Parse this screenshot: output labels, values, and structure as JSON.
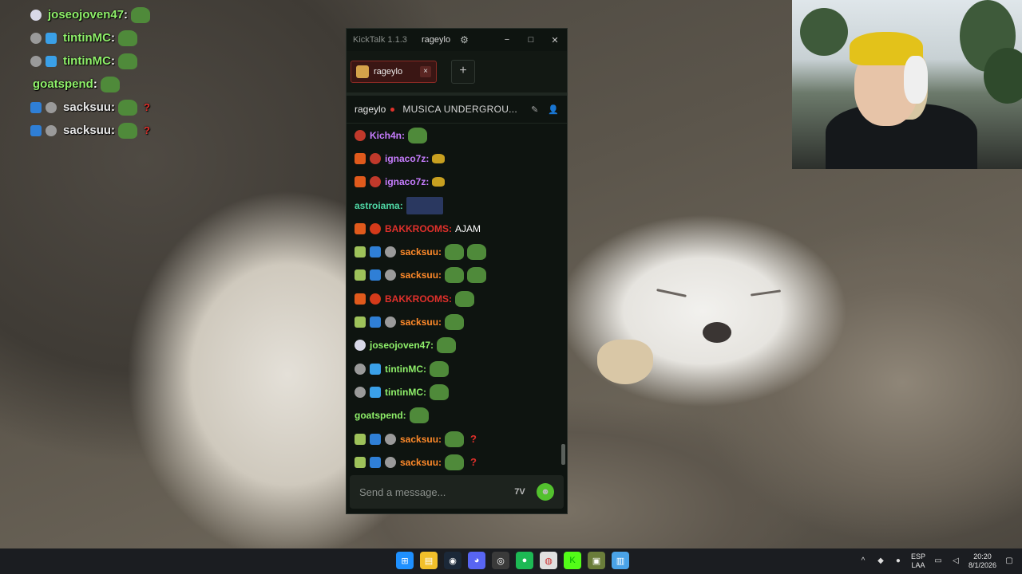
{
  "overlay_chat": [
    {
      "user": "joseojoven47",
      "color": "#8ff06a",
      "badges": [
        "silver-badge"
      ],
      "emotes": [
        "pepe-emote"
      ],
      "text": "",
      "suffix": ""
    },
    {
      "user": "tintinMC",
      "color": "#8ff06a",
      "badges": [
        "gray-badge",
        "cube-badge"
      ],
      "emotes": [
        "pepe-emote"
      ],
      "text": "",
      "suffix": ""
    },
    {
      "user": "tintinMC",
      "color": "#8ff06a",
      "badges": [
        "gray-badge",
        "cube-badge"
      ],
      "emotes": [
        "pepe-emote"
      ],
      "text": "",
      "suffix": ""
    },
    {
      "user": "goatspend",
      "color": "#8ff06a",
      "badges": [],
      "emotes": [
        "pepe-emote"
      ],
      "text": "",
      "suffix": ""
    },
    {
      "user": "sacksuu",
      "color": "#e8e8e8",
      "badges": [
        "sword-badge",
        "gray-badge"
      ],
      "emotes": [
        "pepe-emote"
      ],
      "text": "",
      "suffix": "?"
    },
    {
      "user": "sacksuu",
      "color": "#e8e8e8",
      "badges": [
        "sword-badge",
        "gray-badge"
      ],
      "emotes": [
        "pepe-emote"
      ],
      "text": "",
      "suffix": "?"
    }
  ],
  "window": {
    "app_title": "KickTalk 1.1.3",
    "channel": "rageylo",
    "tab_label": "rageylo",
    "tab_close": "×",
    "add_tab": "+",
    "minimize": "−",
    "maximize": "□",
    "close": "✕"
  },
  "channel_bar": {
    "name": "rageylo",
    "stream_title": "MUSICA UNDERGROU..."
  },
  "messages": [
    {
      "badges": [
        "red-badge"
      ],
      "user": "Kich4n",
      "color": "#c77dff",
      "emotes": [
        "pepe"
      ],
      "text": "",
      "suffix": ""
    },
    {
      "badges": [
        "orange-badge",
        "red-badge"
      ],
      "user": "ignaco7z",
      "color": "#c77dff",
      "emotes": [
        "small"
      ],
      "text": "",
      "suffix": ""
    },
    {
      "badges": [
        "orange-badge",
        "red-badge"
      ],
      "user": "ignaco7z",
      "color": "#c77dff",
      "emotes": [
        "small"
      ],
      "text": "",
      "suffix": ""
    },
    {
      "badges": [],
      "user": "astroiama",
      "color": "#4fd6a4",
      "emotes": [
        "wide"
      ],
      "text": "",
      "suffix": ""
    },
    {
      "badges": [
        "orange-badge",
        "fire-badge"
      ],
      "user": "BAKKROOMS",
      "color": "#e0302b",
      "emotes": [],
      "text": "AJAM",
      "suffix": ""
    },
    {
      "badges": [
        "alien-badge",
        "sword-badge",
        "gray-badge"
      ],
      "user": "sacksuu",
      "color": "#ff8a2a",
      "emotes": [
        "pepe",
        "pepe"
      ],
      "text": "",
      "suffix": ""
    },
    {
      "badges": [
        "alien-badge",
        "sword-badge",
        "gray-badge"
      ],
      "user": "sacksuu",
      "color": "#ff8a2a",
      "emotes": [
        "pepe",
        "pepe"
      ],
      "text": "",
      "suffix": ""
    },
    {
      "badges": [
        "orange-badge",
        "fire-badge"
      ],
      "user": "BAKKROOMS",
      "color": "#e0302b",
      "emotes": [
        "pepe"
      ],
      "text": "",
      "suffix": ""
    },
    {
      "badges": [
        "alien-badge",
        "sword-badge",
        "gray-badge"
      ],
      "user": "sacksuu",
      "color": "#ff8a2a",
      "emotes": [
        "pepe"
      ],
      "text": "",
      "suffix": ""
    },
    {
      "badges": [
        "silver-badge"
      ],
      "user": "joseojoven47",
      "color": "#8ff06a",
      "emotes": [
        "pepe"
      ],
      "text": "",
      "suffix": ""
    },
    {
      "badges": [
        "gray-badge",
        "cube-badge"
      ],
      "user": "tintinMC",
      "color": "#8ff06a",
      "emotes": [
        "pepe"
      ],
      "text": "",
      "suffix": ""
    },
    {
      "badges": [
        "gray-badge",
        "cube-badge"
      ],
      "user": "tintinMC",
      "color": "#8ff06a",
      "emotes": [
        "pepe"
      ],
      "text": "",
      "suffix": ""
    },
    {
      "badges": [],
      "user": "goatspend",
      "color": "#8ff06a",
      "emotes": [
        "pepe"
      ],
      "text": "",
      "suffix": ""
    },
    {
      "badges": [
        "alien-badge",
        "sword-badge",
        "gray-badge"
      ],
      "user": "sacksuu",
      "color": "#ff8a2a",
      "emotes": [
        "pepe"
      ],
      "text": "",
      "suffix": "?"
    },
    {
      "badges": [
        "alien-badge",
        "sword-badge",
        "gray-badge"
      ],
      "user": "sacksuu",
      "color": "#ff8a2a",
      "emotes": [
        "pepe"
      ],
      "text": "",
      "suffix": "?"
    }
  ],
  "input": {
    "placeholder": "Send a message..."
  },
  "badge_colors": {
    "red-badge": "#c0392b",
    "orange-badge": "#e05a1c",
    "fire-badge": "#d43a1a",
    "alien-badge": "#9ec25a",
    "sword-badge": "#2f7fd6",
    "gray-badge": "#9a9a9a",
    "cube-badge": "#3aa0e8",
    "silver-badge": "#d8d8e8"
  },
  "taskbar": {
    "apps": [
      "windows-start-icon",
      "file-explorer-icon",
      "steam-icon",
      "discord-icon",
      "kicktalk-icon",
      "spotify-icon",
      "chrome-icon",
      "kick-icon",
      "game-icon",
      "notepad-icon"
    ],
    "language_top": "ESP",
    "language_bottom": "LAA",
    "time": "20:20",
    "date": "8/1/2026"
  }
}
